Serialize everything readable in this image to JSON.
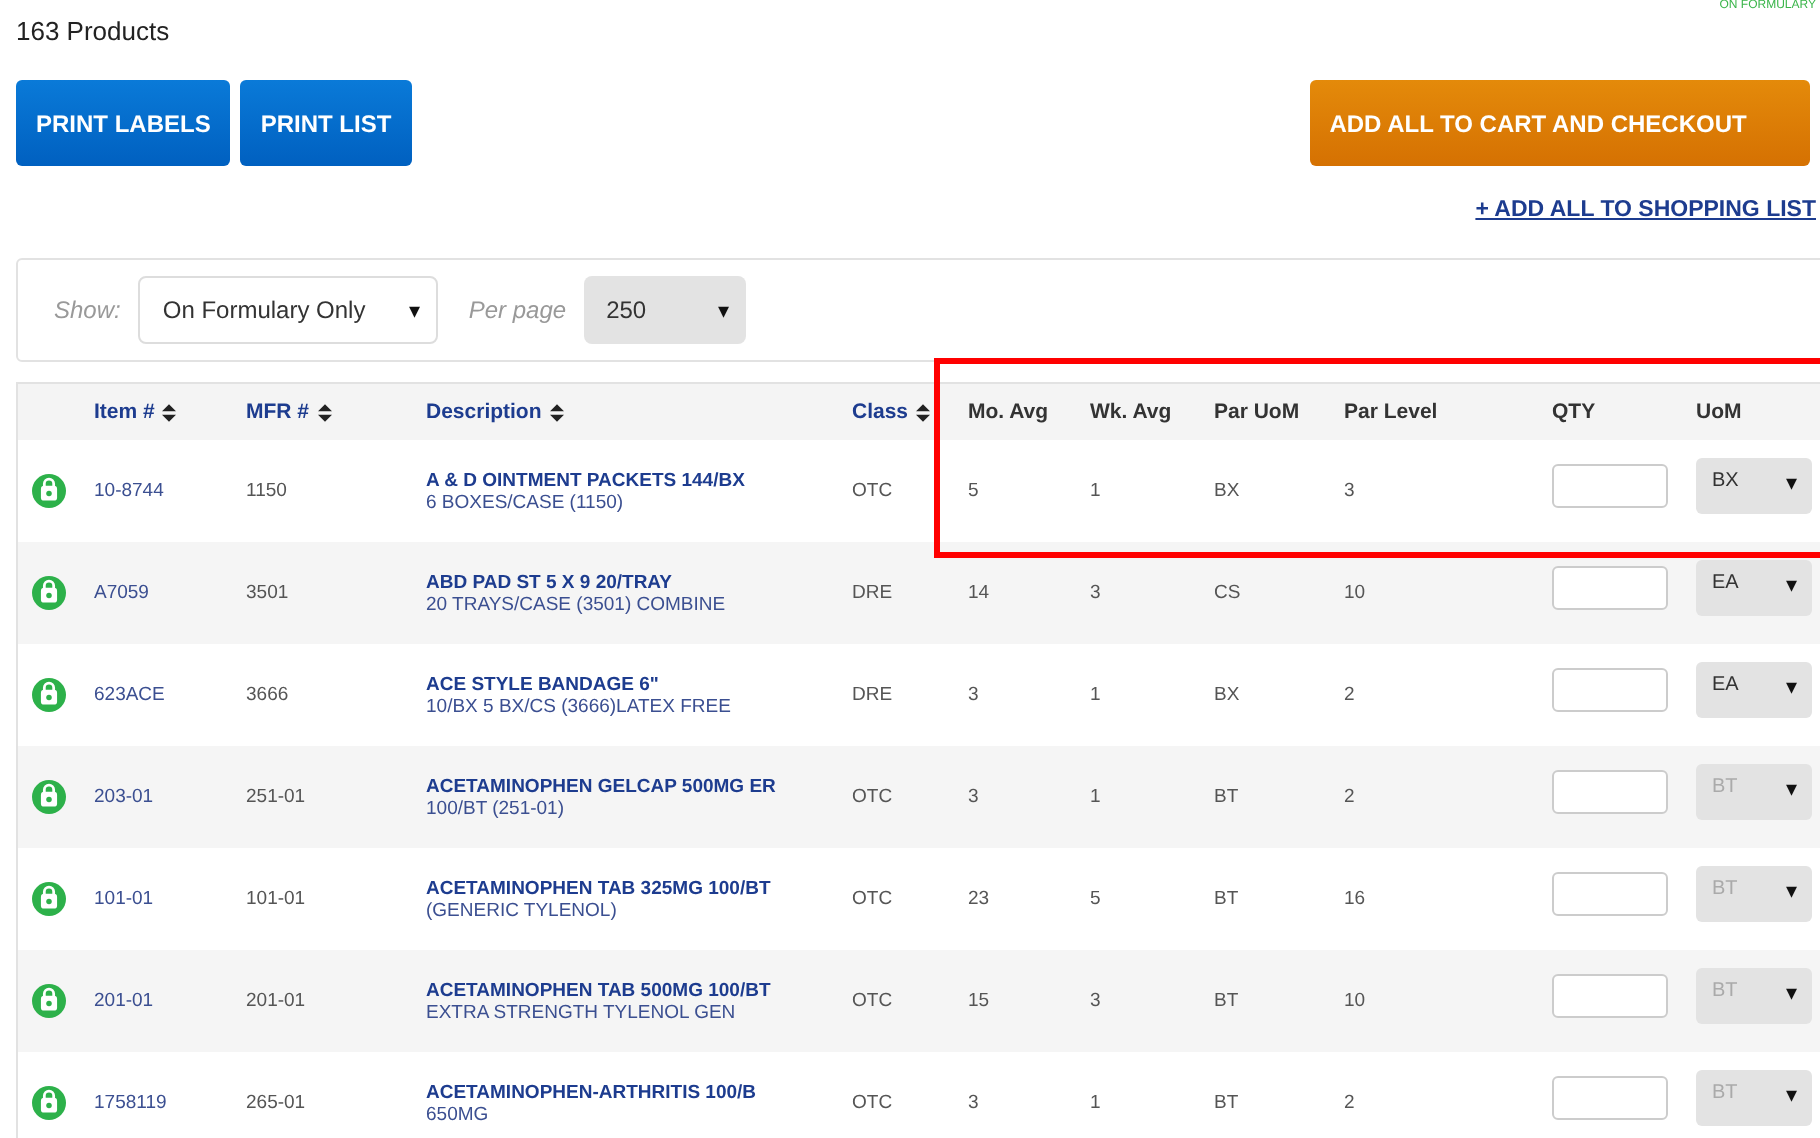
{
  "formulary_note": "ON FORMULARY",
  "product_count": "163 Products",
  "buttons": [
    {
      "label": "PRINT LABELS",
      "kind": "primary"
    },
    {
      "label": "PRINT LIST",
      "kind": "primary"
    },
    {
      "label": "ADD ALL TO CART AND CHECKOUT",
      "kind": "checkout"
    }
  ],
  "shopping_list_link": "+ ADD ALL TO SHOPPING LIST",
  "filters": {
    "show_label": "Show:",
    "show_value": "On Formulary Only",
    "per_page_label": "Per page",
    "per_page_value": "250",
    "caret": "▾"
  },
  "table": {
    "columns": [
      {
        "label": "Item #",
        "sortable": true
      },
      {
        "label": "MFR #",
        "sortable": true
      },
      {
        "label": "Description",
        "sortable": true
      },
      {
        "label": "Class",
        "sortable": true
      },
      {
        "label": "Mo. Avg",
        "sortable": false
      },
      {
        "label": "Wk. Avg",
        "sortable": false
      },
      {
        "label": "Par UoM",
        "sortable": false
      },
      {
        "label": "Par Level",
        "sortable": false
      },
      {
        "label": "QTY",
        "sortable": false
      },
      {
        "label": "UoM",
        "sortable": false
      }
    ],
    "rows": [
      {
        "item": "10-8744",
        "mfr": "1150",
        "title": "A & D OINTMENT PACKETS 144/BX",
        "subtitle": "6 BOXES/CASE (1150)",
        "class": "OTC",
        "mo_avg": "5",
        "wk_avg": "1",
        "par_uom": "BX",
        "par_level": "3",
        "uom": "BX",
        "uom_disabled": false
      },
      {
        "item": "A7059",
        "mfr": "3501",
        "title": "ABD PAD ST 5 X 9 20/TRAY",
        "subtitle": "20 TRAYS/CASE (3501) COMBINE",
        "class": "DRE",
        "mo_avg": "14",
        "wk_avg": "3",
        "par_uom": "CS",
        "par_level": "10",
        "uom": "EA",
        "uom_disabled": false
      },
      {
        "item": "623ACE",
        "mfr": "3666",
        "title": "ACE STYLE BANDAGE 6\"",
        "subtitle": "10/BX 5 BX/CS (3666)LATEX FREE",
        "class": "DRE",
        "mo_avg": "3",
        "wk_avg": "1",
        "par_uom": "BX",
        "par_level": "2",
        "uom": "EA",
        "uom_disabled": false
      },
      {
        "item": "203-01",
        "mfr": "251-01",
        "title": "ACETAMINOPHEN GELCAP 500MG ER",
        "subtitle": "100/BT (251-01)",
        "class": "OTC",
        "mo_avg": "3",
        "wk_avg": "1",
        "par_uom": "BT",
        "par_level": "2",
        "uom": "BT",
        "uom_disabled": true
      },
      {
        "item": "101-01",
        "mfr": "101-01",
        "title": "ACETAMINOPHEN TAB 325MG 100/BT",
        "subtitle": "(GENERIC TYLENOL)",
        "class": "OTC",
        "mo_avg": "23",
        "wk_avg": "5",
        "par_uom": "BT",
        "par_level": "16",
        "uom": "BT",
        "uom_disabled": true
      },
      {
        "item": "201-01",
        "mfr": "201-01",
        "title": "ACETAMINOPHEN TAB 500MG 100/BT",
        "subtitle": "EXTRA STRENGTH TYLENOL GEN",
        "class": "OTC",
        "mo_avg": "15",
        "wk_avg": "3",
        "par_uom": "BT",
        "par_level": "10",
        "uom": "BT",
        "uom_disabled": true
      },
      {
        "item": "1758119",
        "mfr": "265-01",
        "title": "ACETAMINOPHEN-ARTHRITIS 100/B",
        "subtitle": "650MG",
        "class": "OTC",
        "mo_avg": "3",
        "wk_avg": "1",
        "par_uom": "BT",
        "par_level": "2",
        "uom": "BT",
        "uom_disabled": true
      }
    ]
  }
}
